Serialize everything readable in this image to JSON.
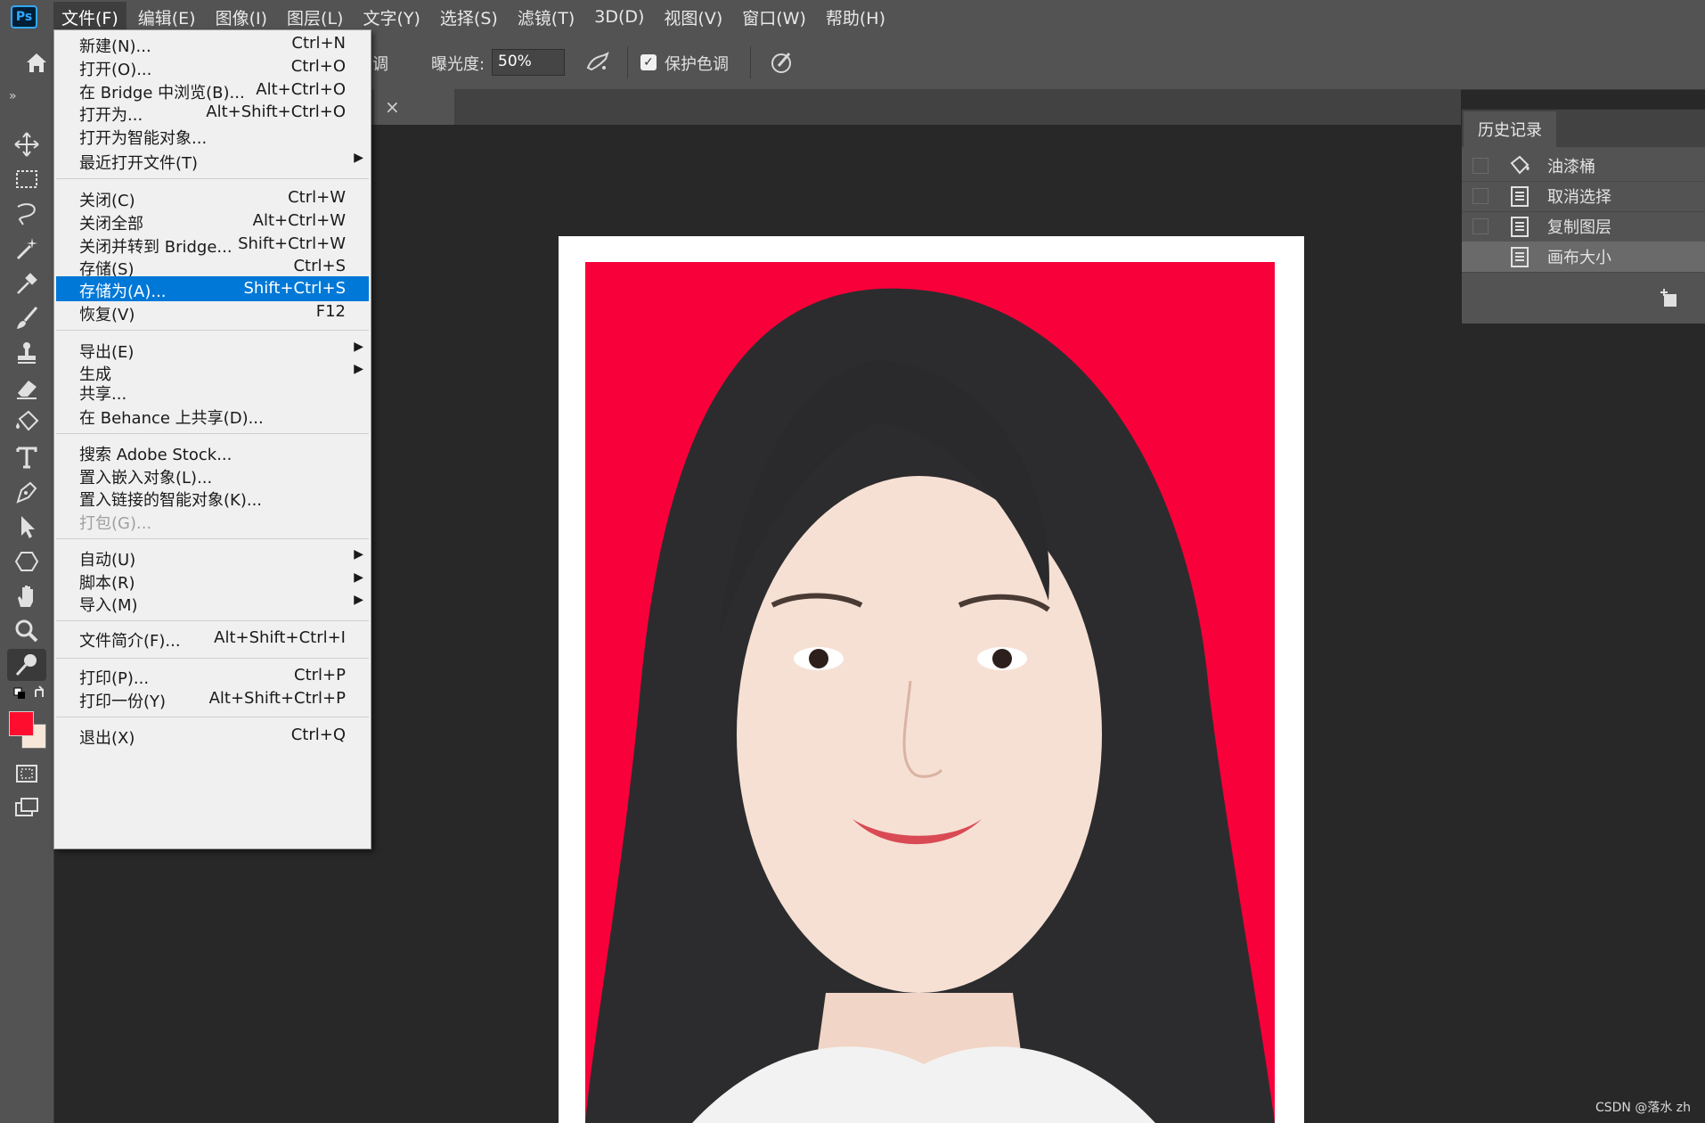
{
  "app": {
    "logo": "Ps"
  },
  "menubar": {
    "items": [
      "文件(F)",
      "编辑(E)",
      "图像(I)",
      "图层(L)",
      "文字(Y)",
      "选择(S)",
      "滤镜(T)",
      "3D(D)",
      "视图(V)",
      "窗口(W)",
      "帮助(H)"
    ],
    "active_index": 0
  },
  "options": {
    "partial_label": "调",
    "exposure_label": "曝光度:",
    "exposure_value": "50%",
    "protect_tones_label": "保护色调",
    "protect_tones_checked": true
  },
  "file_menu": {
    "items": [
      {
        "label": "新建(N)...",
        "shortcut": "Ctrl+N"
      },
      {
        "label": "打开(O)...",
        "shortcut": "Ctrl+O"
      },
      {
        "label": "在 Bridge 中浏览(B)...",
        "shortcut": "Alt+Ctrl+O"
      },
      {
        "label": "打开为...",
        "shortcut": "Alt+Shift+Ctrl+O"
      },
      {
        "label": "打开为智能对象...",
        "shortcut": ""
      },
      {
        "label": "最近打开文件(T)",
        "shortcut": "",
        "submenu": true
      },
      {
        "label": "关闭(C)",
        "shortcut": "Ctrl+W"
      },
      {
        "label": "关闭全部",
        "shortcut": "Alt+Ctrl+W"
      },
      {
        "label": "关闭并转到 Bridge...",
        "shortcut": "Shift+Ctrl+W"
      },
      {
        "label": "存储(S)",
        "shortcut": "Ctrl+S"
      },
      {
        "label": "存储为(A)...",
        "shortcut": "Shift+Ctrl+S",
        "highlighted": true
      },
      {
        "label": "恢复(V)",
        "shortcut": "F12"
      },
      {
        "label": "导出(E)",
        "shortcut": "",
        "submenu": true
      },
      {
        "label": "生成",
        "shortcut": "",
        "submenu": true
      },
      {
        "label": "共享...",
        "shortcut": ""
      },
      {
        "label": "在 Behance 上共享(D)...",
        "shortcut": ""
      },
      {
        "label": "搜索 Adobe Stock...",
        "shortcut": ""
      },
      {
        "label": "置入嵌入对象(L)...",
        "shortcut": ""
      },
      {
        "label": "置入链接的智能对象(K)...",
        "shortcut": ""
      },
      {
        "label": "打包(G)...",
        "shortcut": "",
        "disabled": true
      },
      {
        "label": "自动(U)",
        "shortcut": "",
        "submenu": true
      },
      {
        "label": "脚本(R)",
        "shortcut": "",
        "submenu": true
      },
      {
        "label": "导入(M)",
        "shortcut": "",
        "submenu": true
      },
      {
        "label": "文件简介(F)...",
        "shortcut": "Alt+Shift+Ctrl+I"
      },
      {
        "label": "打印(P)...",
        "shortcut": "Ctrl+P"
      },
      {
        "label": "打印一份(Y)",
        "shortcut": "Alt+Shift+Ctrl+P"
      },
      {
        "label": "退出(X)",
        "shortcut": "Ctrl+Q"
      }
    ]
  },
  "history": {
    "tab_label": "历史记录",
    "items": [
      {
        "label": "油漆桶",
        "icon": "paint-bucket-icon"
      },
      {
        "label": "取消选择",
        "icon": "document-icon"
      },
      {
        "label": "复制图层",
        "icon": "document-icon"
      },
      {
        "label": "画布大小",
        "icon": "document-icon",
        "current": true
      }
    ]
  },
  "colors": {
    "foreground": "#ff0d2e",
    "background": "#f6e7d9",
    "photo_background": "#f8003a",
    "menu_highlight": "#0078d7"
  },
  "watermark": "CSDN @落水 zh"
}
